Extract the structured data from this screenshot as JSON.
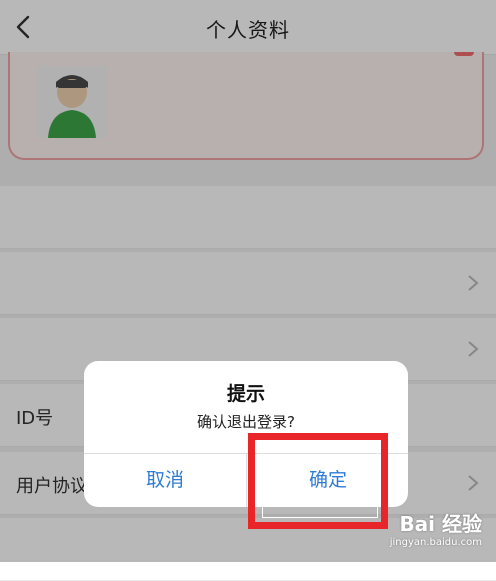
{
  "navbar": {
    "title": "个人资料"
  },
  "profile": {
    "tag": "",
    "nickname": ""
  },
  "rows": [
    {
      "label": "",
      "value": ""
    },
    {
      "label": "",
      "value": ""
    },
    {
      "label": "",
      "value": ""
    },
    {
      "label": "ID号",
      "value": ""
    },
    {
      "label": "用户协议",
      "value": ""
    },
    {
      "label": "",
      "value": ""
    }
  ],
  "dialog": {
    "title": "提示",
    "message": "确认退出登录?",
    "cancel_label": "取消",
    "ok_label": "确定"
  },
  "watermark": {
    "text": "Bai 经验",
    "url": "jingyan.baidu.com"
  },
  "colors": {
    "dialog_button": "#2f7bd6",
    "highlight_border": "#e8262a",
    "profile_border": "#f0a3a3",
    "profile_tag": "#f26c6c"
  },
  "icons": [
    "back-arrow-icon",
    "chevron-right-icon",
    "avatar-icon",
    "baidu-paw-icon"
  ]
}
